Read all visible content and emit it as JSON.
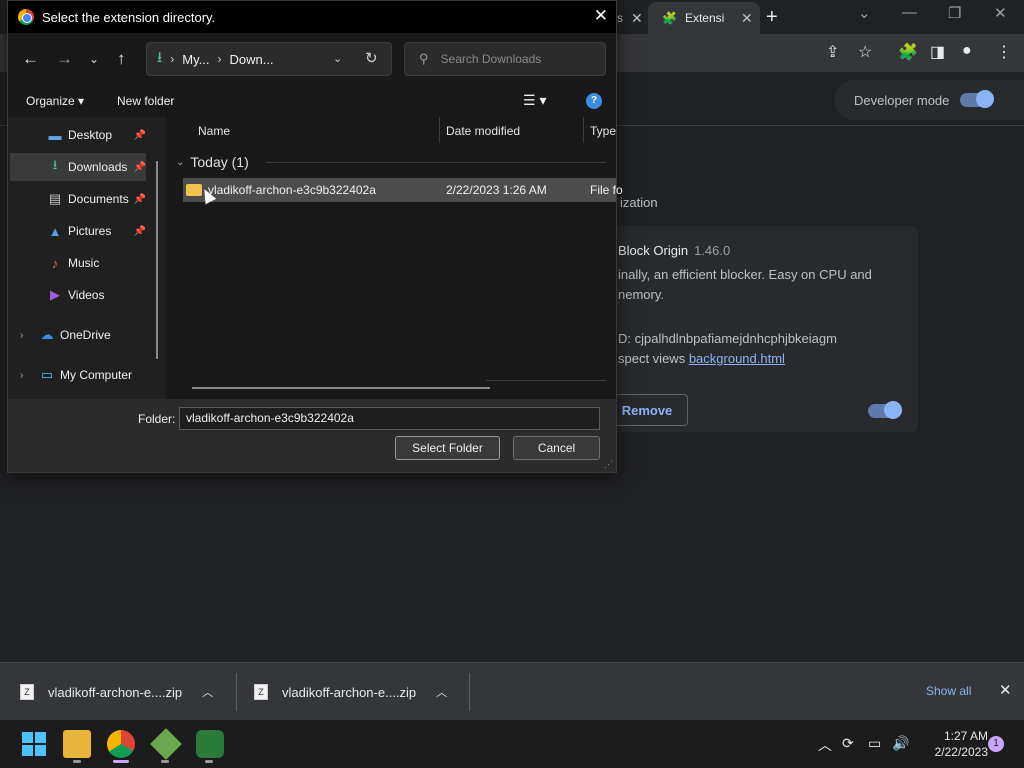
{
  "browser": {
    "tabs": [
      {
        "label": "s",
        "close": "✕"
      },
      {
        "label": "Extensi",
        "close": "✕"
      }
    ],
    "new_tab": "+",
    "window_controls": [
      "⌄",
      "—",
      "❐",
      "✕"
    ],
    "toolbar_icons": [
      "share-icon",
      "star-icon",
      "puzzle-icon",
      "sidepanel-icon",
      "profile-icon",
      "menu-icon"
    ]
  },
  "extensions_page": {
    "developer_mode_label": "Developer mode",
    "developer_mode_on": true,
    "section_title": "ization",
    "card": {
      "name": "Block Origin",
      "version": "1.46.0",
      "desc_line1": "inally, an efficient blocker. Easy on CPU and",
      "desc_line2": "nemory.",
      "id_line": "D: cjpalhdlnbpafiamejdnhcphjbkeiagm",
      "inspect_prefix": "spect views",
      "inspect_link": "background.html",
      "remove_label": "Remove",
      "enabled": true
    }
  },
  "downloads_bar": {
    "items": [
      {
        "name": "vladikoff-archon-e....zip"
      },
      {
        "name": "vladikoff-archon-e....zip"
      }
    ],
    "show_all": "Show all",
    "close": "✕"
  },
  "taskbar": {
    "time": "1:27 AM",
    "date": "2/22/2023",
    "notifications": "1"
  },
  "dialog": {
    "title": "Select the extension directory.",
    "close": "✕",
    "breadcrumb": [
      "My...",
      "Down..."
    ],
    "search_placeholder": "Search Downloads",
    "organize": "Organize ▾",
    "new_folder": "New folder",
    "help": "?",
    "nav_items": [
      {
        "label": "Desktop",
        "icon": "desktop-icon",
        "pinned": true
      },
      {
        "label": "Downloads",
        "icon": "download-icon",
        "pinned": true,
        "selected": true
      },
      {
        "label": "Documents",
        "icon": "documents-icon",
        "pinned": true
      },
      {
        "label": "Pictures",
        "icon": "pictures-icon",
        "pinned": true
      },
      {
        "label": "Music",
        "icon": "music-icon",
        "pinned": false
      },
      {
        "label": "Videos",
        "icon": "videos-icon",
        "pinned": false
      },
      {
        "label": "OneDrive",
        "icon": "cloud-icon",
        "pinned": false
      },
      {
        "label": "My Computer",
        "icon": "computer-icon",
        "pinned": false
      }
    ],
    "columns": {
      "name": "Name",
      "date": "Date modified",
      "type": "Type"
    },
    "group": "Today (1)",
    "files": [
      {
        "name": "vladikoff-archon-e3c9b322402a",
        "date": "2/22/2023 1:26 AM",
        "type": "File fo"
      }
    ],
    "folder_label": "Folder:",
    "folder_value": "vladikoff-archon-e3c9b322402a",
    "select_button": "Select Folder",
    "cancel_button": "Cancel"
  }
}
